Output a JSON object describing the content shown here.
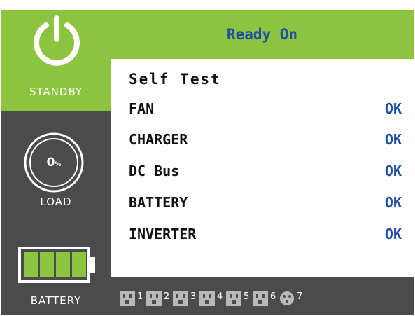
{
  "header": {
    "title": "Ready On"
  },
  "status_panel": {
    "mode_label": "STANDBY",
    "mode_icon": "power-icon",
    "load_value": "0",
    "load_unit": "%",
    "load_label": "LOAD",
    "battery_label": "BATTERY",
    "battery_icon": "battery-full-icon",
    "battery_level_fraction": 1.0
  },
  "self_test": {
    "title": "Self Test",
    "items": [
      {
        "name": "FAN",
        "status": "OK"
      },
      {
        "name": "CHARGER",
        "status": "OK"
      },
      {
        "name": "DC Bus",
        "status": "OK"
      },
      {
        "name": "BATTERY",
        "status": "OK"
      },
      {
        "name": "INVERTER",
        "status": "OK"
      }
    ]
  },
  "outlets": [
    {
      "number": "1",
      "icon": "outlet-icon"
    },
    {
      "number": "2",
      "icon": "outlet-icon"
    },
    {
      "number": "3",
      "icon": "outlet-icon"
    },
    {
      "number": "4",
      "icon": "outlet-icon"
    },
    {
      "number": "5",
      "icon": "outlet-icon"
    },
    {
      "number": "6",
      "icon": "outlet-icon"
    },
    {
      "number": "7",
      "icon": "round-outlet-icon"
    }
  ],
  "colors": {
    "green": "#8dc43f",
    "dark_gray": "#4b4b4b",
    "status_blue": "#1e4ea8",
    "outlet_gray": "#b9b9b9"
  }
}
